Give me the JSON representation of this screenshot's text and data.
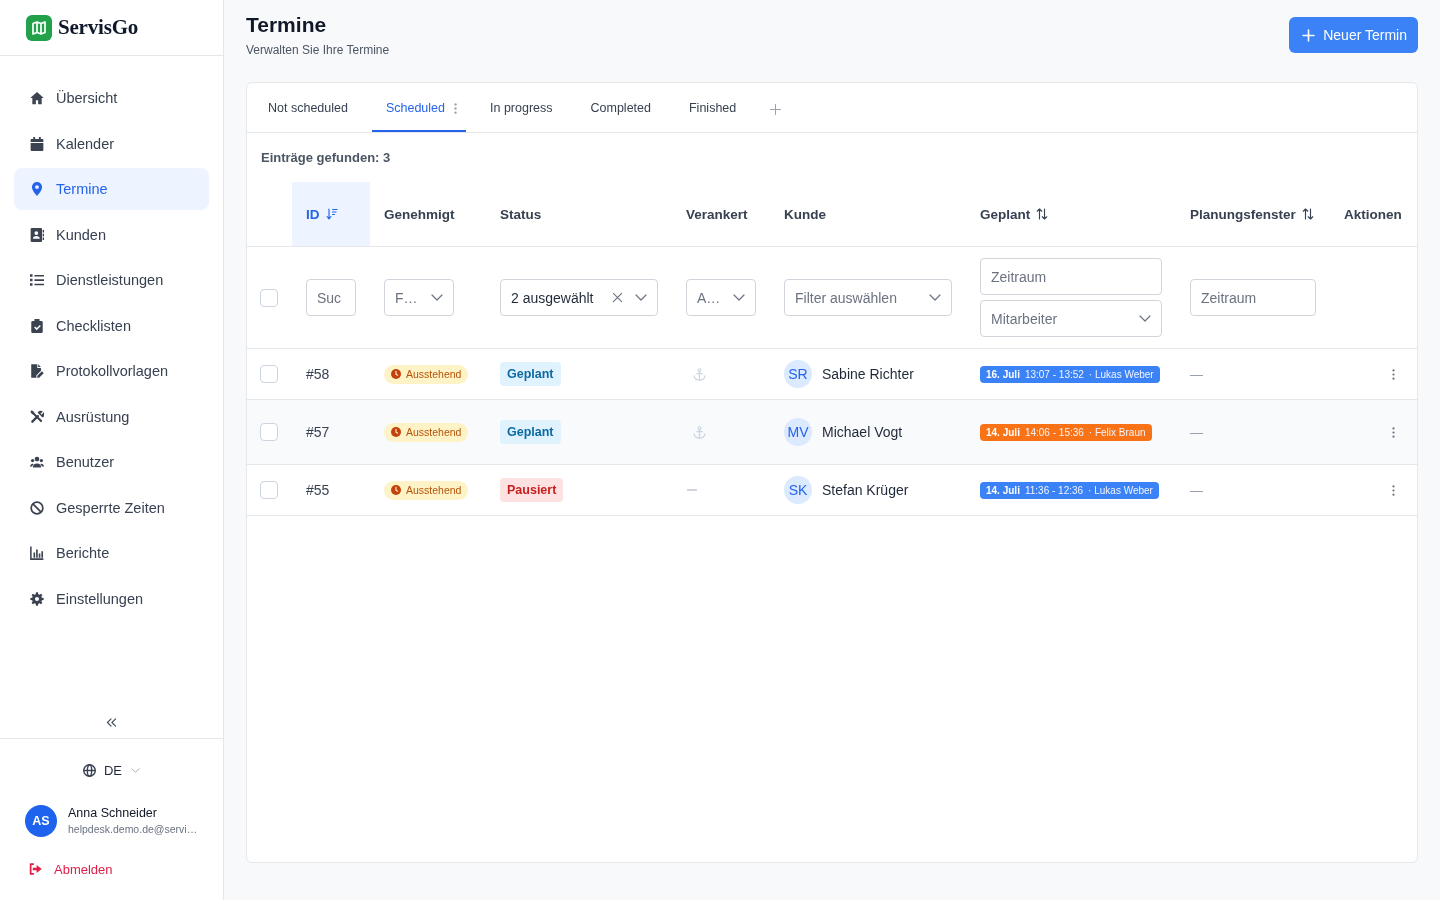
{
  "brand": {
    "name": "ServisGo"
  },
  "sidebar": {
    "items": [
      {
        "label": "Übersicht",
        "selected": false
      },
      {
        "label": "Kalender",
        "selected": false
      },
      {
        "label": "Termine",
        "selected": true
      },
      {
        "label": "Kunden",
        "selected": false
      },
      {
        "label": "Dienstleistungen",
        "selected": false
      },
      {
        "label": "Checklisten",
        "selected": false
      },
      {
        "label": "Protokollvorlagen",
        "selected": false
      },
      {
        "label": "Ausrüstung",
        "selected": false
      },
      {
        "label": "Benutzer",
        "selected": false
      },
      {
        "label": "Gesperrte Zeiten",
        "selected": false
      },
      {
        "label": "Berichte",
        "selected": false
      },
      {
        "label": "Einstellungen",
        "selected": false
      }
    ],
    "language": "DE",
    "user": {
      "initials": "AS",
      "name": "Anna Schneider",
      "email": "helpdesk.demo.de@servi…"
    },
    "logout": "Abmelden"
  },
  "page": {
    "title": "Termine",
    "subtitle": "Verwalten Sie Ihre Termine",
    "new_button": "Neuer Termin"
  },
  "tabs": [
    {
      "label": "Not scheduled",
      "selected": false
    },
    {
      "label": "Scheduled",
      "selected": true
    },
    {
      "label": "In progress",
      "selected": false
    },
    {
      "label": "Completed",
      "selected": false
    },
    {
      "label": "Finished",
      "selected": false
    }
  ],
  "results_label": "Einträge gefunden: 3",
  "table": {
    "select_all": {
      "checked": false
    },
    "columns": [
      {
        "label": "ID",
        "sortable": true,
        "sorted": true,
        "filters": [
          {
            "kind": "input",
            "placeholder": "Suc"
          }
        ]
      },
      {
        "label": "Genehmigt",
        "sortable": false,
        "sorted": false,
        "filters": [
          {
            "kind": "select",
            "placeholder": "F…",
            "clearable": false
          }
        ]
      },
      {
        "label": "Status",
        "sortable": false,
        "sorted": false,
        "filters": [
          {
            "kind": "select",
            "value": "2 ausgewählt",
            "clearable": true
          }
        ]
      },
      {
        "label": "Verankert",
        "sortable": false,
        "sorted": false,
        "filters": [
          {
            "kind": "select",
            "placeholder": "A…",
            "clearable": false
          }
        ]
      },
      {
        "label": "Kunde",
        "sortable": false,
        "sorted": false,
        "filters": [
          {
            "kind": "select",
            "placeholder": "Filter auswählen",
            "clearable": false
          }
        ]
      },
      {
        "label": "Geplant",
        "sortable": true,
        "sorted": false,
        "filters": [
          {
            "kind": "input",
            "placeholder": "Zeitraum"
          },
          {
            "kind": "select",
            "placeholder": "Mitarbeiter",
            "clearable": false
          }
        ]
      },
      {
        "label": "Planungsfenster",
        "sortable": true,
        "sorted": false,
        "filters": [
          {
            "kind": "input",
            "placeholder": "Zeitraum"
          }
        ]
      },
      {
        "label": "Aktionen",
        "sortable": false,
        "sorted": false
      }
    ],
    "rows": [
      {
        "checked": false,
        "hovered": false,
        "id": "#58",
        "approval": "Ausstehend",
        "status": {
          "label": "Geplant",
          "kind": "scheduled"
        },
        "anchored": true,
        "customer": {
          "initials": "SR",
          "name": "Sabine Richter"
        },
        "schedule": {
          "date": "16. Juli",
          "time": "13:07 - 13:52",
          "employee": "· Lukas Weber",
          "color": "#3b82f6"
        },
        "window": "—"
      },
      {
        "checked": false,
        "hovered": true,
        "id": "#57",
        "approval": "Ausstehend",
        "status": {
          "label": "Geplant",
          "kind": "scheduled"
        },
        "anchored": true,
        "customer": {
          "initials": "MV",
          "name": "Michael Vogt"
        },
        "schedule": {
          "date": "14. Juli",
          "time": "14:06 - 15:36",
          "employee": "· Felix Braun",
          "color": "#f97316"
        },
        "window": "—"
      },
      {
        "checked": false,
        "hovered": false,
        "id": "#55",
        "approval": "Ausstehend",
        "status": {
          "label": "Pausiert",
          "kind": "paused"
        },
        "anchored": false,
        "customer": {
          "initials": "SK",
          "name": "Stefan Krüger"
        },
        "schedule": {
          "date": "14. Juli",
          "time": "11:36 - 12:36",
          "employee": "· Lukas Weber",
          "color": "#3b82f6"
        },
        "window": "—"
      }
    ]
  }
}
